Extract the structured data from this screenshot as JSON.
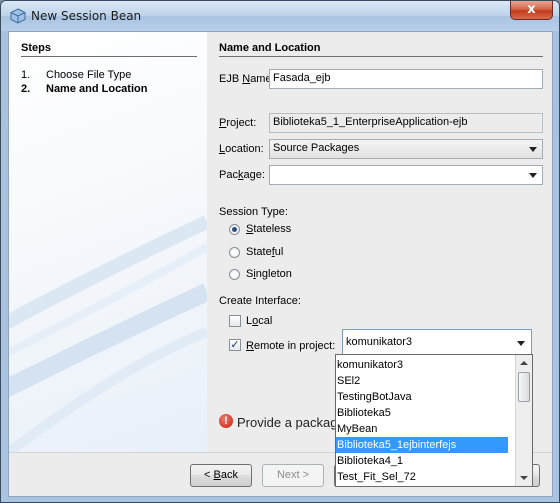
{
  "window": {
    "title": "New Session Bean",
    "close_glyph": "x"
  },
  "steps": {
    "heading": "Steps",
    "items": [
      {
        "num": "1.",
        "label": "Choose File Type"
      },
      {
        "num": "2.",
        "label": "Name and Location"
      }
    ]
  },
  "form": {
    "heading": "Name and Location",
    "ejb_name": {
      "label_pre": "EJB ",
      "label_u": "N",
      "label_post": "ame:",
      "value": "Fasada_ejb"
    },
    "project": {
      "label_pre": "",
      "label_u": "P",
      "label_post": "roject:",
      "value": "Biblioteka5_1_EnterpriseApplication-ejb"
    },
    "location": {
      "label_pre": "",
      "label_u": "L",
      "label_post": "ocation:",
      "value": "Source Packages"
    },
    "package": {
      "label_pre": "Pac",
      "label_u": "k",
      "label_post": "age:",
      "value": ""
    },
    "session_type": {
      "label": "Session Type:",
      "options": [
        {
          "pre": "",
          "u": "S",
          "post": "tateless",
          "selected": true
        },
        {
          "pre": "State",
          "u": "f",
          "post": "ul",
          "selected": false
        },
        {
          "pre": "S",
          "u": "i",
          "post": "ngleton",
          "selected": false
        }
      ]
    },
    "create_interface": {
      "label": "Create Interface:",
      "local": {
        "pre": "L",
        "u": "o",
        "post": "cal",
        "checked": false
      },
      "remote": {
        "pre": "",
        "u": "R",
        "post": "emote in project:",
        "checked": true,
        "value": "komunikator3"
      }
    },
    "remote_dropdown": {
      "items": [
        "komunikator3",
        "SEl2",
        "TestingBotJava",
        "Biblioteka5",
        "MyBean",
        "Biblioteka5_1ejbinterfejs",
        "Biblioteka4_1",
        "Test_Fit_Sel_72"
      ],
      "selected_index": 5
    },
    "error": {
      "icon": "error-icon",
      "text": "Provide a package"
    }
  },
  "buttons": {
    "back": {
      "pre": "< ",
      "u": "B",
      "post": "ack"
    },
    "next": {
      "label": "Next >"
    }
  }
}
